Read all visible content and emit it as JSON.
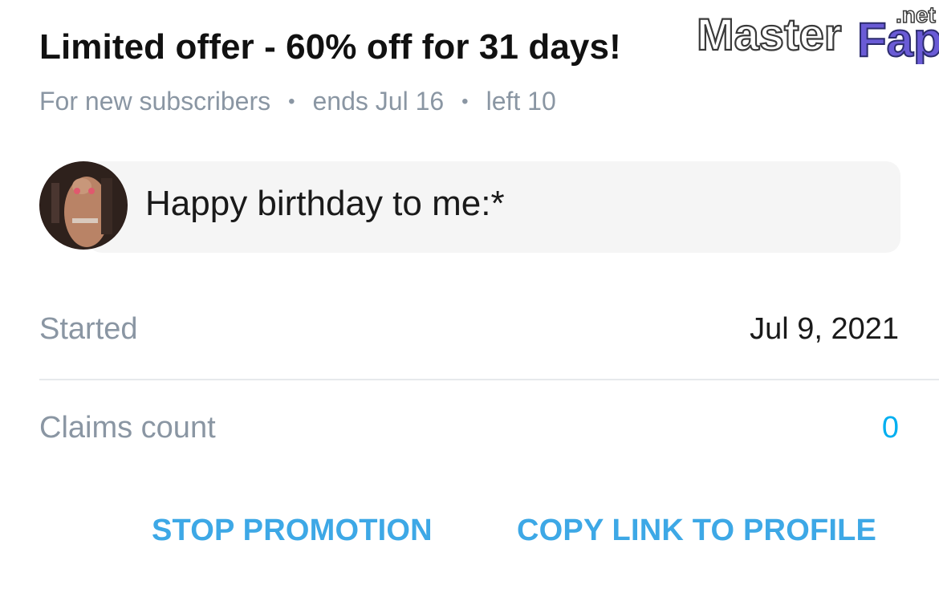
{
  "offer": {
    "title": "Limited offer - 60% off for 31 days!",
    "audience": "For new subscribers",
    "ends": "ends Jul 16",
    "left": "left 10",
    "separator": "•"
  },
  "message": {
    "text": "Happy birthday to me:*"
  },
  "stats": {
    "started_label": "Started",
    "started_value": "Jul 9, 2021",
    "claims_label": "Claims count",
    "claims_value": "0"
  },
  "actions": {
    "stop_label": "STOP PROMOTION",
    "copy_label": "COPY LINK TO PROFILE"
  },
  "watermark": {
    "text_main": "Master",
    "text_accent": "Fap",
    "text_tld": ".net"
  },
  "colors": {
    "accent": "#00aff0",
    "button": "#3da8e6",
    "muted": "#8a96a3",
    "text": "#111111"
  }
}
